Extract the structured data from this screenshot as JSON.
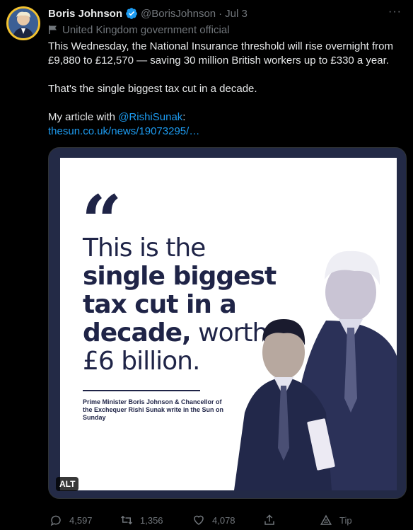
{
  "tweet": {
    "author_name": "Boris Johnson",
    "handle": "@BorisJohnson",
    "separator": "·",
    "date": "Jul 3",
    "more_label": "···",
    "account_label": "United Kingdom government official",
    "paragraphs": [
      "This Wednesday, the National Insurance threshold will rise overnight from £9,880 to £12,570 — saving 30 million British workers up to £330 a year.",
      "That's the single biggest tax cut in a decade."
    ],
    "article_prefix": "My article with ",
    "mention": "@RishiSunak",
    "article_suffix": ":",
    "link": "thesun.co.uk/news/19073295/…",
    "verified_color": "#1d9bf0"
  },
  "media": {
    "quote_mark": "“",
    "headline_part1": "This is the ",
    "headline_bold": "single biggest tax cut in a decade,",
    "headline_part2": " worth £6 billion.",
    "caption": "Prime Minister Boris Johnson & Chancellor of the Exchequer Rishi Sunak write in the Sun on Sunday",
    "alt_label": "ALT",
    "accent_color": "#1f2447"
  },
  "actions": {
    "replies": "4,597",
    "retweets": "1,356",
    "likes": "4,078",
    "share_icon": "share-icon",
    "tip_label": "Tip"
  }
}
